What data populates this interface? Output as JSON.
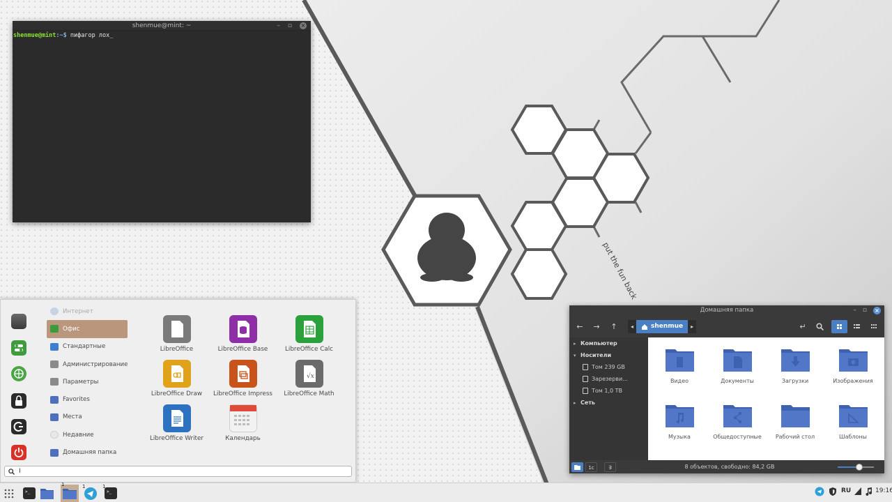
{
  "wallpaper": {
    "tagline": "put the fun back"
  },
  "terminal": {
    "title": "shenmue@mint: ~",
    "prompt_user": "shenmue@mint",
    "prompt_path": ":~$",
    "command": " пифагор лох",
    "cursor": "_",
    "min_glyph": "–",
    "max_glyph": "▫",
    "close_glyph": "×"
  },
  "menu": {
    "categories": [
      {
        "label": "Интернет",
        "icon": "globe-icon",
        "state": "dim"
      },
      {
        "label": "Офис",
        "icon": "office-icon",
        "state": "active"
      },
      {
        "label": "Стандартные",
        "icon": "accessories-icon",
        "state": ""
      },
      {
        "label": "Администрирование",
        "icon": "admin-icon",
        "state": ""
      },
      {
        "label": "Параметры",
        "icon": "settings-icon",
        "state": ""
      },
      {
        "label": "Favorites",
        "icon": "favorites-folder-icon",
        "state": ""
      },
      {
        "label": "Места",
        "icon": "places-folder-icon",
        "state": ""
      },
      {
        "label": "Недавние",
        "icon": "recent-icon",
        "state": ""
      },
      {
        "label": "Домашняя папка",
        "icon": "home-folder-icon",
        "state": ""
      }
    ],
    "apps": [
      {
        "label": "LibreOffice",
        "color": "#7a7a7a"
      },
      {
        "label": "LibreOffice Base",
        "color": "#8e2fa8"
      },
      {
        "label": "LibreOffice Calc",
        "color": "#2aa13c"
      },
      {
        "label": "LibreOffice Draw",
        "color": "#e0a21b"
      },
      {
        "label": "LibreOffice Impress",
        "color": "#c8541c"
      },
      {
        "label": "LibreOffice Math",
        "color": "#6b6b6b"
      },
      {
        "label": "LibreOffice Writer",
        "color": "#2c72c0"
      },
      {
        "label": "Календарь",
        "color": "#e8e8e8"
      }
    ],
    "search_value": "I"
  },
  "file_manager": {
    "title": "Домашняя папка",
    "path_crumb": "shenmue",
    "sidebar": [
      {
        "label": "Компьютер",
        "type": "header",
        "caret": "▸"
      },
      {
        "label": "Носители",
        "type": "header",
        "caret": "▾"
      },
      {
        "label": "Том 239 GB",
        "type": "device"
      },
      {
        "label": "Зарезерви...",
        "type": "device"
      },
      {
        "label": "Том 1,0 TB",
        "type": "device"
      },
      {
        "label": "Сеть",
        "type": "header",
        "caret": "▸"
      }
    ],
    "items": [
      {
        "label": "Видео",
        "icon": "video-folder-icon"
      },
      {
        "label": "Документы",
        "icon": "documents-folder-icon"
      },
      {
        "label": "Загрузки",
        "icon": "downloads-folder-icon"
      },
      {
        "label": "Изображения",
        "icon": "pictures-folder-icon"
      },
      {
        "label": "Музыка",
        "icon": "music-folder-icon"
      },
      {
        "label": "Общедоступные",
        "icon": "public-folder-icon"
      },
      {
        "label": "Рабочий стол",
        "icon": "desktop-folder-icon"
      },
      {
        "label": "Шаблоны",
        "icon": "templates-folder-icon"
      }
    ],
    "status_text": "8 объектов, свободно: 84,2 GB",
    "zoom_fraction": 0.6,
    "status_btn_2": "1c",
    "status_btn_3": "∃",
    "accent_color": "#4a7fc4",
    "folder_color": "#5277c6"
  },
  "taskbar": {
    "badges": [
      "1",
      "1",
      "1"
    ],
    "lang": "RU",
    "clock": "19:16"
  }
}
